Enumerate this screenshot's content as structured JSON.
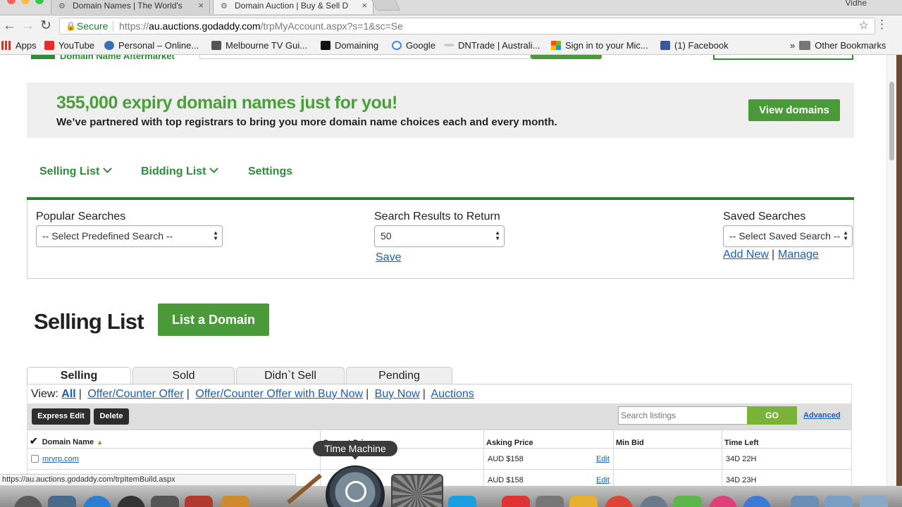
{
  "browser": {
    "tabs": [
      {
        "title": "Domain Names | The World's",
        "active": false
      },
      {
        "title": "Domain Auction | Buy & Sell D",
        "active": true
      }
    ],
    "profile": "Vidhe",
    "secure_label": "Secure",
    "url_scheme": "https://",
    "url_host": "au.auctions.godaddy.com",
    "url_path": "/trpMyAccount.aspx?s=1&sc=Se",
    "bookmarks": [
      {
        "label": "Apps",
        "icon": "apps-grid-icon",
        "color": "#c0392b"
      },
      {
        "label": "YouTube",
        "icon": "youtube-icon",
        "color": "#e52d27"
      },
      {
        "label": "Personal – Online...",
        "icon": "personal-icon",
        "color": "#3a6fb0"
      },
      {
        "label": "Melbourne TV Gui...",
        "icon": "tv-icon",
        "color": "#555555"
      },
      {
        "label": "Domaining",
        "icon": "domaining-icon",
        "color": "#111111"
      },
      {
        "label": "Google",
        "icon": "google-icon",
        "color": "#4285f4"
      },
      {
        "label": "DNTrade | Australi...",
        "icon": "dntrade-icon",
        "color": "#999999"
      },
      {
        "label": "Sign in to your Mic...",
        "icon": "microsoft-icon",
        "color": "#f25022"
      },
      {
        "label": "(1) Facebook",
        "icon": "facebook-icon",
        "color": "#3b5998"
      }
    ],
    "other_bookmarks": "Other Bookmarks",
    "status_url": "https://au.auctions.godaddy.com/trpItemBuild.aspx"
  },
  "header": {
    "tagline": "Domain Name Aftermarket"
  },
  "promo": {
    "headline": "355,000 expiry domain names just for you!",
    "subline": "We’ve partnered with top registrars to bring you more domain name choices each and every month.",
    "button": "View domains"
  },
  "subnav": {
    "selling": "Selling List",
    "bidding": "Bidding List",
    "settings": "Settings"
  },
  "search": {
    "popular_label": "Popular Searches",
    "popular_value": "-- Select Predefined Search --",
    "results_label": "Search Results to Return",
    "results_value": "50",
    "save": "Save",
    "saved_label": "Saved Searches",
    "saved_value": "-- Select Saved Search --",
    "add_new": "Add New",
    "manage": "Manage"
  },
  "selling": {
    "title": "Selling List",
    "list_button": "List a Domain",
    "tabs": [
      "Selling",
      "Sold",
      "Didn`t Sell",
      "Pending"
    ],
    "view_label": "View:",
    "views": [
      "All",
      "Offer/Counter Offer",
      "Offer/Counter Offer with Buy Now",
      "Buy Now",
      "Auctions"
    ],
    "express_edit": "Express Edit",
    "delete": "Delete",
    "search_placeholder": "Search listings",
    "go": "GO",
    "advanced": "Advanced",
    "columns": [
      "Domain Name",
      "Current Price",
      "Asking Price",
      "Min Bid",
      "Time Left"
    ],
    "rows": [
      {
        "domain": "mrvrp.com",
        "price": "",
        "asking": "AUD $158",
        "edit": "Edit",
        "min_bid": "",
        "time_left": "34D 22H"
      },
      {
        "domain": "",
        "price": "",
        "asking": "AUD $158",
        "edit": "Edit",
        "min_bid": "",
        "time_left": "34D 23H"
      }
    ]
  },
  "dock": {
    "tooltip": "Time Machine"
  },
  "colors": {
    "brand_green": "#2e8b37",
    "button_green": "#4a9a3a",
    "link_blue": "#1a5fb4"
  }
}
